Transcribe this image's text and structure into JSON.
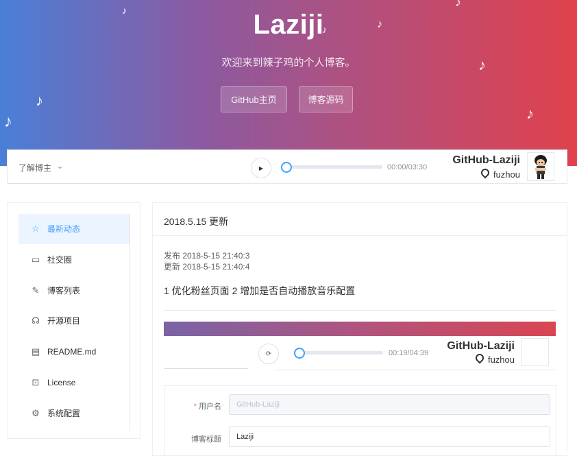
{
  "hero": {
    "title": "Laziji",
    "subtitle": "欢迎来到辣子鸡的个人博客。",
    "buttons": [
      "GitHub主页",
      "博客源码"
    ],
    "note_glyph": "♪",
    "gradient": [
      "#4a7fd8",
      "#8c5aa0",
      "#b54f7a",
      "#e0414c"
    ]
  },
  "player": {
    "about_label": "了解博主",
    "about_chevron": "⌄",
    "play_glyph": "▶",
    "progress": 0.0,
    "time": "00:00/03:30",
    "name": "GitHub-Laziji",
    "location": "fuzhou"
  },
  "sidebar": {
    "items": [
      {
        "label": "最新动态",
        "icon": "☆",
        "active": true
      },
      {
        "label": "社交圈",
        "icon": "▭"
      },
      {
        "label": "博客列表",
        "icon": "✎"
      },
      {
        "label": "开源项目",
        "icon": "☊"
      },
      {
        "label": "README.md",
        "icon": "▤"
      },
      {
        "label": "License",
        "icon": "⊡"
      },
      {
        "label": "系统配置",
        "icon": "⚙"
      }
    ]
  },
  "post": {
    "title": "2018.5.15 更新",
    "published": "发布 2018-5-15 21:40:3",
    "updated": "更新 2018-5-15 21:40:4",
    "body": "1 优化粉丝页面 2 增加是否自动播放音乐配置"
  },
  "inner_player": {
    "loop_glyph": "⟳",
    "progress": 0.0,
    "time": "00:19/04:39",
    "name": "GitHub-Laziji",
    "location": "fuzhou"
  },
  "form": {
    "username_label": "用户名",
    "required_mark": "*",
    "username_value": "GitHub-Laziji",
    "blog_title_label": "博客标题",
    "blog_title_value": "Laziji"
  },
  "colors": {
    "accent": "#409eff",
    "active_bg": "#ecf5ff",
    "required": "#f56c6c"
  }
}
